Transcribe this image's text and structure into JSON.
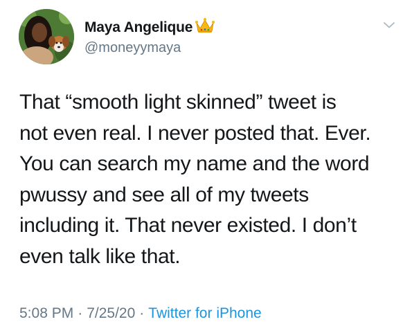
{
  "tweet": {
    "author": {
      "display_name": "Maya Angelique",
      "handle": "@moneyymaya",
      "badge_icon": "crown-emoji-icon"
    },
    "body_lines": [
      "That “smooth light skinned” tweet is",
      "not even real. I never posted that. Ever.",
      "You can search my name and the word",
      "pwussy and see all of my tweets",
      "including it. That never existed. I don’t",
      "even talk like that."
    ],
    "meta": {
      "time": "5:08 PM",
      "separator": "·",
      "date": "7/25/20",
      "source": "Twitter for iPhone"
    }
  },
  "colors": {
    "text": "#14171a",
    "secondary": "#657786",
    "link": "#1b95e0"
  }
}
